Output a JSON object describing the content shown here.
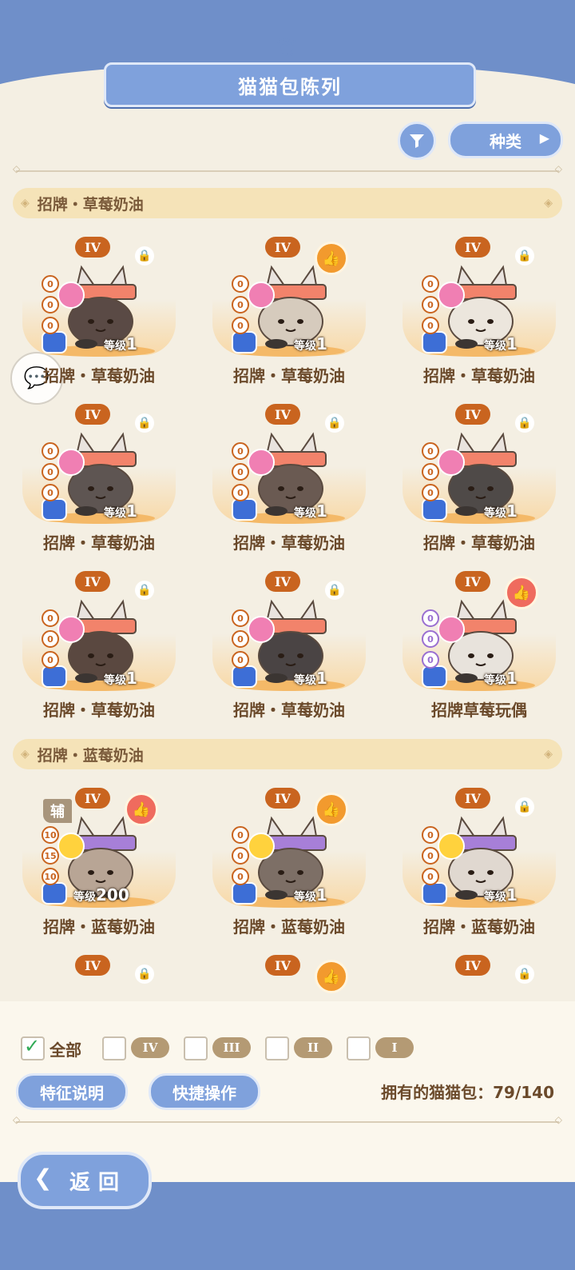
{
  "header": {
    "title": "猫猫包陈列"
  },
  "toolbar": {
    "filter_icon": "filter-icon",
    "kind_label": "种类"
  },
  "sections": [
    {
      "title": "招牌・草莓奶油",
      "cards": [
        {
          "tier": "IV",
          "name": "招牌・草莓奶油",
          "level_prefix": "等级",
          "level": "1",
          "stars": [
            "0",
            "0",
            "0"
          ],
          "status": "lock"
        },
        {
          "tier": "IV",
          "name": "招牌・草莓奶油",
          "level_prefix": "等级",
          "level": "1",
          "stars": [
            "0",
            "0",
            "0"
          ],
          "status": "thumb-orange"
        },
        {
          "tier": "IV",
          "name": "招牌・草莓奶油",
          "level_prefix": "等级",
          "level": "1",
          "stars": [
            "0",
            "0",
            "0"
          ],
          "status": "lock"
        },
        {
          "tier": "IV",
          "name": "招牌・草莓奶油",
          "level_prefix": "等级",
          "level": "1",
          "stars": [
            "0",
            "0",
            "0"
          ],
          "status": "lock"
        },
        {
          "tier": "IV",
          "name": "招牌・草莓奶油",
          "level_prefix": "等级",
          "level": "1",
          "stars": [
            "0",
            "0",
            "0"
          ],
          "status": "lock"
        },
        {
          "tier": "IV",
          "name": "招牌・草莓奶油",
          "level_prefix": "等级",
          "level": "1",
          "stars": [
            "0",
            "0",
            "0"
          ],
          "status": "lock"
        },
        {
          "tier": "IV",
          "name": "招牌・草莓奶油",
          "level_prefix": "等级",
          "level": "1",
          "stars": [
            "0",
            "0",
            "0"
          ],
          "status": "lock"
        },
        {
          "tier": "IV",
          "name": "招牌・草莓奶油",
          "level_prefix": "等级",
          "level": "1",
          "stars": [
            "0",
            "0",
            "0"
          ],
          "status": "lock"
        },
        {
          "tier": "IV",
          "name": "招牌草莓玩偶",
          "level_prefix": "等级",
          "level": "1",
          "stars": [
            "0",
            "0",
            "0"
          ],
          "status": "thumb-red"
        }
      ]
    },
    {
      "title": "招牌・蓝莓奶油",
      "cards": [
        {
          "tier": "IV",
          "name": "招牌・蓝莓奶油",
          "level_prefix": "等级",
          "level": "200",
          "stars": [
            "10",
            "15",
            "10"
          ],
          "status": "thumb-red",
          "assist": "辅"
        },
        {
          "tier": "IV",
          "name": "招牌・蓝莓奶油",
          "level_prefix": "等级",
          "level": "1",
          "stars": [
            "0",
            "0",
            "0"
          ],
          "status": "thumb-orange"
        },
        {
          "tier": "IV",
          "name": "招牌・蓝莓奶油",
          "level_prefix": "等级",
          "level": "1",
          "stars": [
            "0",
            "0",
            "0"
          ],
          "status": "lock"
        },
        {
          "tier": "IV",
          "status": "lock"
        },
        {
          "tier": "IV",
          "status": "thumb-orange"
        },
        {
          "tier": "IV",
          "status": "lock"
        }
      ]
    }
  ],
  "filters": {
    "all_label": "全部",
    "tiers": [
      "IV",
      "III",
      "II",
      "I"
    ]
  },
  "actions": {
    "feature_label": "特征说明",
    "quick_label": "快捷操作",
    "owned_text": "拥有的猫猫包：79/140"
  },
  "footer": {
    "back_label": "返回"
  },
  "colors": {
    "accent_blue": "#7fa1dc",
    "tier_orange": "#c9641f",
    "background": "#f4efe3"
  }
}
